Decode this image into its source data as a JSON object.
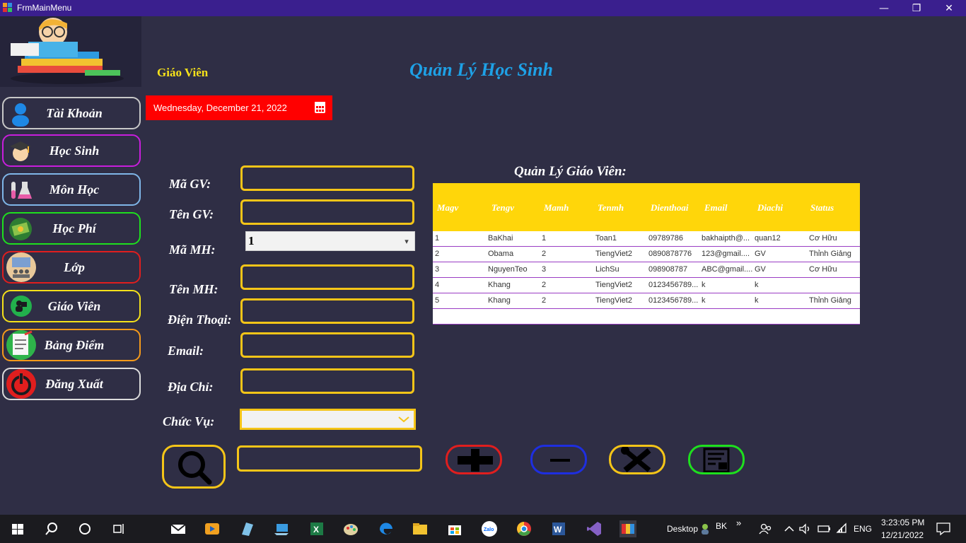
{
  "window": {
    "title": "FrmMainMenu"
  },
  "header": {
    "role": "Giáo Viên",
    "app_title": "Quản Lý Học Sinh",
    "date": "Wednesday, December 21, 2022"
  },
  "sidebar": {
    "items": [
      {
        "label": "Tài Khoản",
        "color": "#c8c8c8"
      },
      {
        "label": "Học Sinh",
        "color": "#c81edc"
      },
      {
        "label": "Môn Học",
        "color": "#7fb6e8"
      },
      {
        "label": "Học Phí",
        "color": "#1ee01e"
      },
      {
        "label": "Lớp",
        "color": "#e01e1e"
      },
      {
        "label": "Giáo Viên",
        "color": "#f5e11a"
      },
      {
        "label": "Bảng Điểm",
        "color": "#f59a1a"
      },
      {
        "label": "Đăng Xuất",
        "color": "#dcdcdc"
      }
    ]
  },
  "form": {
    "ma_gv_label": "Mã GV:",
    "ten_gv_label": "Tên GV:",
    "ma_mh_label": "Mã MH:",
    "ma_mh_value": "1",
    "ten_mh_label": "Tên MH:",
    "dien_thoai_label": "Điện Thoại:",
    "email_label": "Email:",
    "dia_chi_label": "Địa Chỉ:",
    "chuc_vu_label": "Chức Vụ:"
  },
  "grid": {
    "title": "Quản Lý Giáo Viên:",
    "columns": [
      "Magv",
      "Tengv",
      "Mamh",
      "Tenmh",
      "Dienthoai",
      "Email",
      "Diachi",
      "Status"
    ],
    "rows": [
      [
        "1",
        "BaKhai",
        "1",
        "Toan1",
        "09789786",
        "bakhaipth@...",
        "quan12",
        "Cơ Hữu"
      ],
      [
        "2",
        "Obama",
        "2",
        "TiengViet2",
        "0890878776",
        "123@gmail....",
        "GV",
        "Thỉnh Giảng"
      ],
      [
        "3",
        "NguyenTeo",
        "3",
        "LichSu",
        "098908787",
        "ABC@gmail....",
        "GV",
        "Cơ Hữu"
      ],
      [
        "4",
        "Khang",
        "2",
        "TiengViet2",
        "0123456789...",
        "k",
        "k",
        ""
      ],
      [
        "5",
        "Khang",
        "2",
        "TiengViet2",
        "0123456789...",
        "k",
        "k",
        "Thỉnh Giảng"
      ]
    ]
  },
  "taskbar": {
    "desktop_label": "Desktop",
    "user_initials": "BK",
    "language": "ENG",
    "time": "3:23:05 PM",
    "date": "12/21/2022"
  },
  "colors": {
    "accent_yellow": "#f5c518",
    "title_blue": "#1ea1e6",
    "titlebar": "#3a1f8e",
    "background": "#2f2e45"
  }
}
